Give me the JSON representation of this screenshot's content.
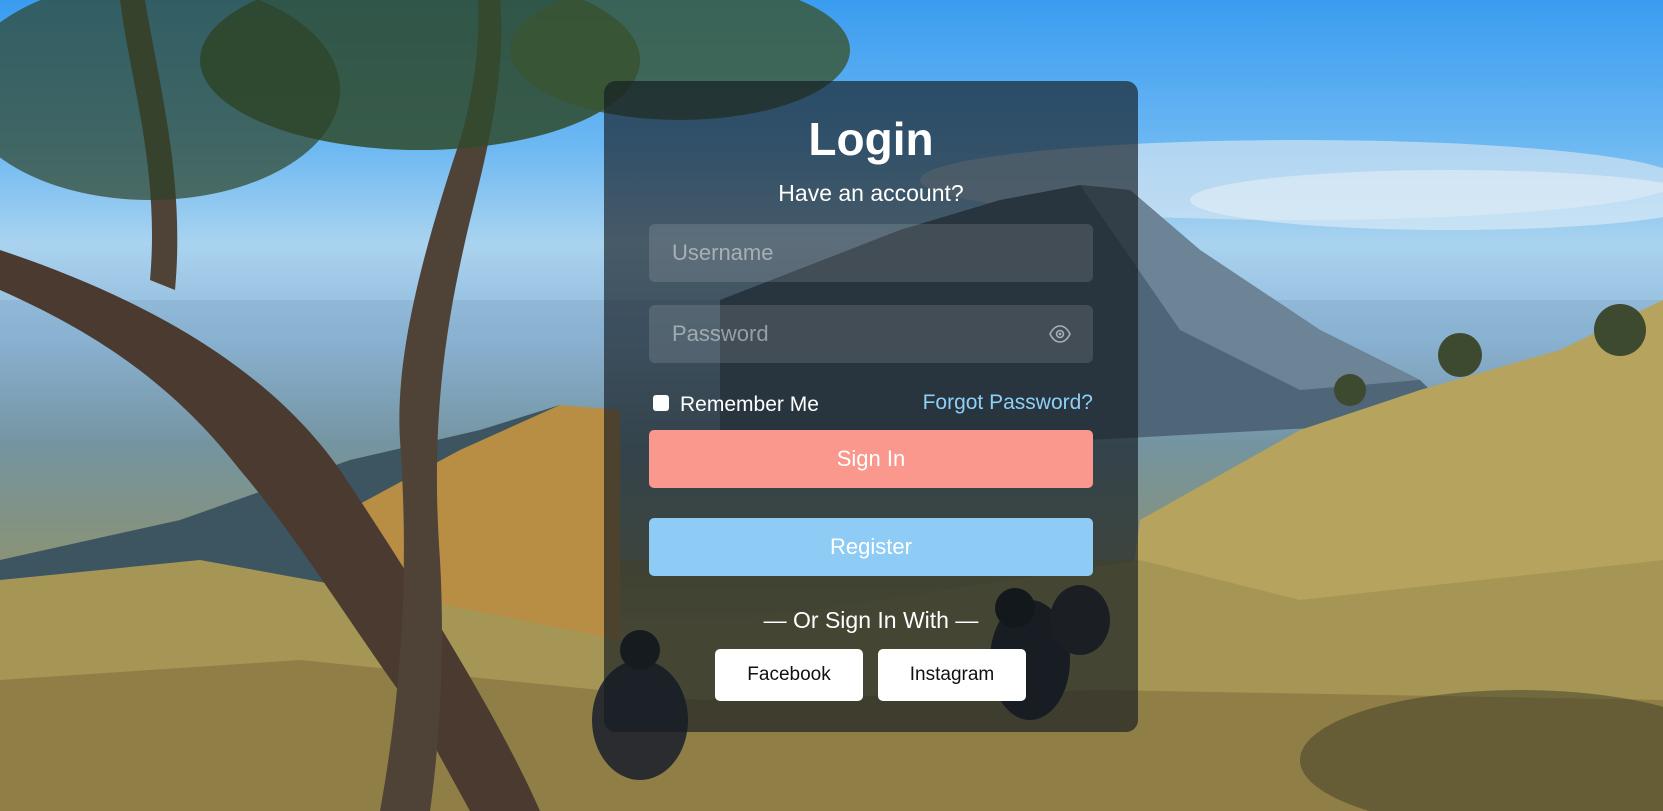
{
  "login": {
    "title": "Login",
    "subtitle": "Have an account?",
    "username_placeholder": "Username",
    "password_placeholder": "Password",
    "remember_label": "Remember Me",
    "remember_checked": false,
    "forgot_label": "Forgot Password?",
    "signin_label": "Sign In",
    "register_label": "Register",
    "divider_text": "— Or Sign In With —",
    "social": {
      "facebook_label": "Facebook",
      "instagram_label": "Instagram"
    }
  },
  "colors": {
    "signin_button": "#fa988d",
    "register_button": "#8ecbf5",
    "forgot_link": "#8ecff6",
    "card_overlay": "rgba(20,28,34,0.66)"
  },
  "icons": {
    "password_toggle": "eye-icon"
  }
}
